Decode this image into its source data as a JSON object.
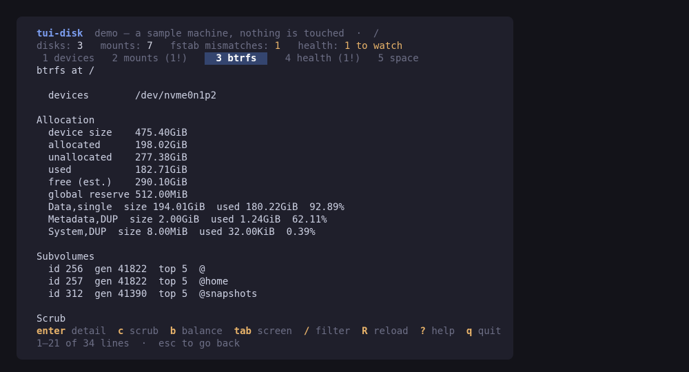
{
  "header": {
    "app_name": "tui-disk",
    "subtitle": "demo — a sample machine, nothing is touched  ·  /"
  },
  "status": {
    "disks_label": "disks:",
    "disks_value": "3",
    "mounts_label": "mounts:",
    "mounts_value": "7",
    "fstab_label": "fstab mismatches:",
    "fstab_value": "1",
    "health_label": "health:",
    "health_value": "1 to watch"
  },
  "tabs": [
    {
      "label": "1 devices",
      "active": false
    },
    {
      "label": "2 mounts (1!)",
      "active": false
    },
    {
      "label": "3 btrfs",
      "active": true
    },
    {
      "label": "4 health (1!)",
      "active": false
    },
    {
      "label": "5 space",
      "active": false
    }
  ],
  "body": {
    "title": "btrfs at /",
    "devices_key": "devices",
    "devices_value": "/dev/nvme0n1p2",
    "allocation_heading": "Allocation",
    "allocation": [
      {
        "key": "device size",
        "value": "475.40GiB"
      },
      {
        "key": "allocated",
        "value": "198.02GiB"
      },
      {
        "key": "unallocated",
        "value": "277.38GiB"
      },
      {
        "key": "used",
        "value": "182.71GiB"
      },
      {
        "key": "free (est.)",
        "value": "290.10GiB"
      }
    ],
    "global_reserve": "global reserve 512.00MiB",
    "profiles": [
      "Data,single  size 194.01GiB  used 180.22GiB  92.89%",
      "Metadata,DUP  size 2.00GiB  used 1.24GiB  62.11%",
      "System,DUP  size 8.00MiB  used 32.00KiB  0.39%"
    ],
    "subvolumes_heading": "Subvolumes",
    "subvolumes": [
      "id 256  gen 41822  top 5  @",
      "id 257  gen 41822  top 5  @home",
      "id 312  gen 41390  top 5  @snapshots"
    ],
    "scrub_heading": "Scrub"
  },
  "keybar": [
    {
      "key": "enter",
      "label": "detail"
    },
    {
      "key": "c",
      "label": "scrub"
    },
    {
      "key": "b",
      "label": "balance"
    },
    {
      "key": "tab",
      "label": "screen"
    },
    {
      "key": "/",
      "label": "filter"
    },
    {
      "key": "R",
      "label": "reload"
    },
    {
      "key": "?",
      "label": "help"
    },
    {
      "key": "q",
      "label": "quit"
    }
  ],
  "footer": {
    "position": "1–21 of 34 lines",
    "separator": "·",
    "hint": "esc to go back"
  },
  "colors": {
    "background": "#131319",
    "panel": "#1f1f2b",
    "accent": "#7d9ff2",
    "warning": "#e8b36a",
    "active_tab": "#34456f"
  }
}
